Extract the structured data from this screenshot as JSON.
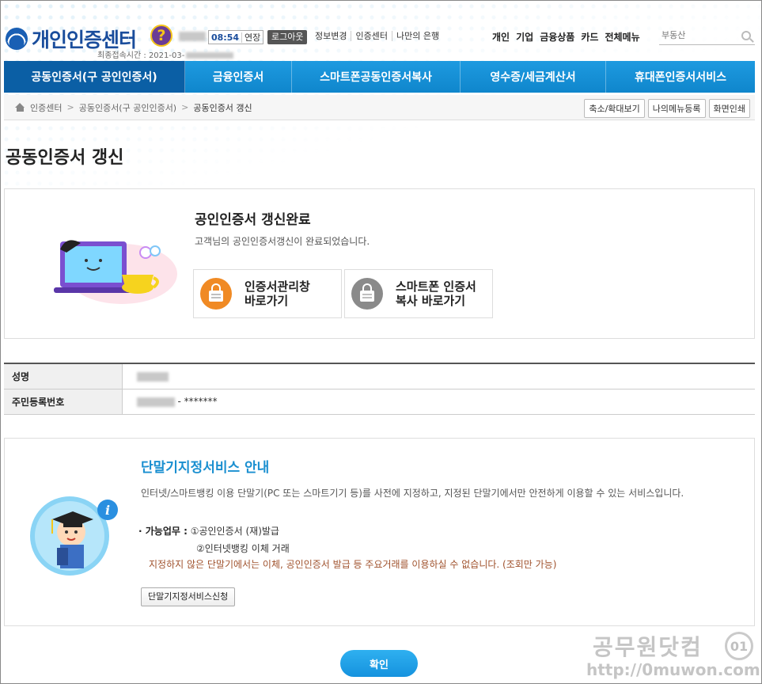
{
  "header": {
    "logo_text": "개인인증센터",
    "help_glyph": "?",
    "timer": "08:54",
    "extend_label": "연장",
    "logout_label": "로그아웃",
    "top_links": [
      "정보변경",
      "인증센터",
      "나만의 은행"
    ],
    "last_access_label": "최종접속시간 :",
    "last_access_value": "2021-03-",
    "gnb": [
      "개인",
      "기업",
      "금융상품",
      "카드",
      "전체메뉴"
    ],
    "search_placeholder": "부동산"
  },
  "main_nav": {
    "tabs": [
      {
        "label": "공동인증서(구 공인인증서)",
        "active": true
      },
      {
        "label": "금융인증서",
        "active": false
      },
      {
        "label": "스마트폰공동인증서복사",
        "active": false
      },
      {
        "label": "영수증/세금계산서",
        "active": false
      },
      {
        "label": "휴대폰인증서서비스",
        "active": false
      }
    ]
  },
  "breadcrumb": {
    "items": [
      "인증센터",
      "공동인증서(구 공인인증서)",
      "공동인증서 갱신"
    ],
    "buttons": [
      "축소/확대보기",
      "나의메뉴등록",
      "화면인쇄"
    ]
  },
  "page_title": "공동인증서 갱신",
  "completion": {
    "title": "공인인증서 갱신완료",
    "description": "고객님의 공인인증서갱신이 완료되었습니다.",
    "btn_manage_line1": "인증서관리창",
    "btn_manage_line2": "바로가기",
    "btn_copy_line1": "스마트폰 인증서",
    "btn_copy_line2": "복사 바로가기",
    "colors": {
      "orange": "#f08a24",
      "gray": "#8a8a8a"
    }
  },
  "info": {
    "name_label": "성명",
    "rrn_label": "주민등록번호",
    "rrn_suffix": "- *******"
  },
  "service": {
    "title": "단말기지정서비스 안내",
    "description": "인터넷/스마트뱅킹 이용 단말기(PC 또는 스마트기기 등)를 사전에 지정하고, 지정된 단말기에서만 안전하게 이용할 수 있는 서비스입니다.",
    "duties_label": "가능업무 :",
    "duty1": "①공인인증서 (재)발급",
    "duty2": "②인터넷뱅킹 이체 거래",
    "warning": "지정하지 않은 단말기에서는 이체, 공인인증서 발급 등 주요거래를 이용하실 수 없습니다. (조회만 가능)",
    "apply_label": "단말기지정서비스신청"
  },
  "confirm_label": "확인",
  "watermark": {
    "line1": "공무원닷컴",
    "line2": "http://0muwon.com"
  }
}
